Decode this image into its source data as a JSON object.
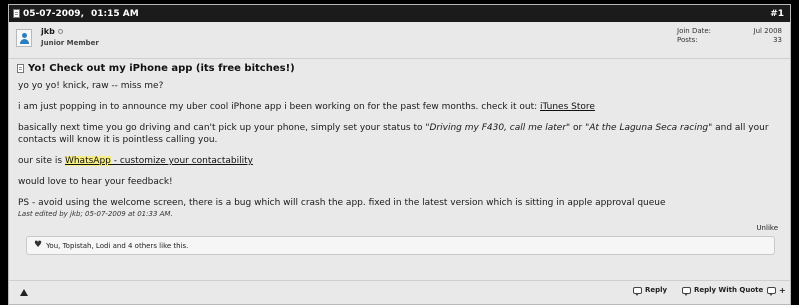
{
  "post": {
    "date": "05-07-2009,",
    "time": "01:15 AM",
    "number": "#1",
    "user": {
      "name": "jkb",
      "rank": "Junior Member",
      "join_label": "Join Date:",
      "join_value": "Jul 2008",
      "posts_label": "Posts:",
      "posts_value": "33"
    },
    "title": "Yo! Check out my iPhone app (its free bitches!)",
    "para1": "yo yo yo! knick, raw -- miss me?",
    "para2_pre": "i am just popping in to announce my uber cool iPhone app i been working on for the past few months. check it out: ",
    "para2_link": "iTunes Store",
    "para3_pre": "basically next time you go driving and can't pick up your phone, simply set your status to \"",
    "para3_em1": "Driving my F430, call me later",
    "para3_mid": "\" or \"",
    "para3_em2": "At the Laguna Seca racing",
    "para3_post": "\" and all your contacts will know it is pointless calling you.",
    "para4_pre": "our site is ",
    "para4_link1": "WhatsApp",
    "para4_link2": " - customize your contactability",
    "para5": "would love to hear your feedback!",
    "para6": "PS - avoid using the welcome screen, there is a bug which will crash the app. fixed in the latest version which is sitting in apple approval queue",
    "edited": "Last edited by jkb; 05-07-2009 at 01:33 AM."
  },
  "likes": {
    "unlike_label": "Unlike",
    "text": "You, Topistah, Lodi and 4 others like this."
  },
  "footer": {
    "reply_label": "Reply",
    "quote_label": "Reply With Quote"
  },
  "icons": {
    "heart": "♥",
    "multiquote": "+"
  }
}
